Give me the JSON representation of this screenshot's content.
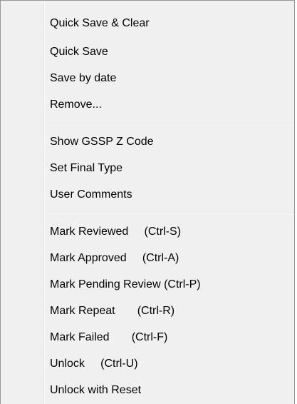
{
  "menu": {
    "group1": [
      "Quick Save & Clear",
      "Quick Save",
      "Save by date",
      "Remove..."
    ],
    "group2": [
      "Show GSSP Z Code",
      "Set Final Type",
      "User Comments"
    ],
    "group3": [
      "Mark Reviewed     (Ctrl-S)",
      "Mark Approved     (Ctrl-A)",
      "Mark Pending Review (Ctrl-P)",
      "Mark Repeat       (Ctrl-R)",
      "Mark Failed       (Ctrl-F)",
      "Unlock     (Ctrl-U)",
      "Unlock with Reset"
    ]
  }
}
